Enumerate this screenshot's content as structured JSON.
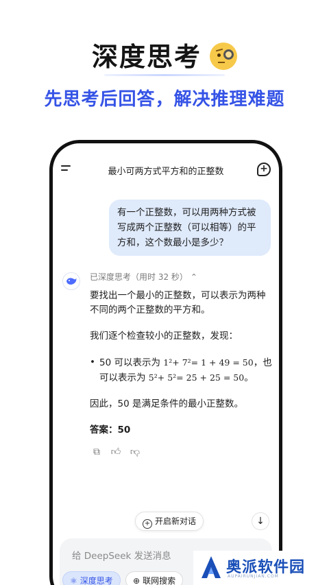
{
  "promo": {
    "title": "深度思考",
    "subtitle": "先思考后回答，解决推理难题"
  },
  "header": {
    "chat_title": "最小可两方式平方和的正整数"
  },
  "user_message": "有一个正整数，可以用两种方式被写成两个正整数（可以相等）的平方和，这个数最小是多少？",
  "assistant": {
    "thinking_status": "已深度思考（用时 32 秒）",
    "para1": "要找出一个最小的正整数，可以表示为两种不同的两个正整数的平方和。",
    "para2": "我们逐个检查较小的正整数，发现：",
    "bullet_lead": "50 可以表示为",
    "bullet_expr1": "1²+ 7²= 1 + 49 = 50",
    "bullet_mid": "，也可以表示为",
    "bullet_expr2": "5²+ 5²= 25 + 25 = 50",
    "bullet_end": "。",
    "para3": "因此，50 是满足条件的最小正整数。",
    "final_answer": "答案：50"
  },
  "controls": {
    "new_chat": "开启新对话",
    "input_placeholder": "给 DeepSeek 发送消息",
    "deep_think": "深度思考",
    "web_search": "联网搜索"
  },
  "watermark": {
    "name": "奥派软件园",
    "sub": "AUPAIRUNJIAN.COM"
  },
  "colors": {
    "accent": "#3553e6",
    "user_bubble": "#dfeafb",
    "input_bg": "#f3f4f6"
  }
}
